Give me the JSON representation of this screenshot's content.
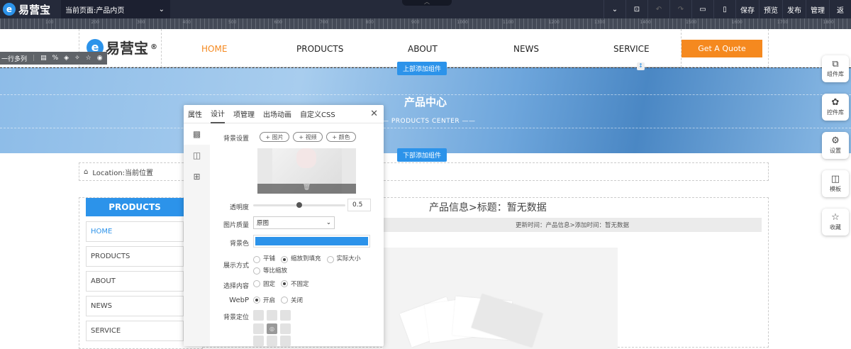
{
  "topbar": {
    "logo_text": "易营宝",
    "page_selector": "当前页面:产品内页",
    "tools": [
      "保存",
      "预览",
      "发布",
      "管理",
      "返"
    ]
  },
  "ruler": {
    "labels": [
      "100",
      "200",
      "300",
      "400",
      "500",
      "600",
      "700",
      "800",
      "900",
      "1000",
      "1100",
      "1200",
      "1300",
      "1400",
      "1500",
      "1600",
      "1700",
      "1800"
    ]
  },
  "header": {
    "logo_text": "易营宝",
    "logo_mark": "®",
    "nav": [
      "HOME",
      "PRODUCTS",
      "ABOUT",
      "NEWS",
      "SERVICE"
    ],
    "quote_button": "Get A Quote"
  },
  "row_toolbar": {
    "label": "一行多列"
  },
  "banner": {
    "add_top": "上部添加组件",
    "title": "产品中心",
    "subtitle": "PRODUCTS CENTER",
    "add_bottom": "下部添加组件"
  },
  "dock": [
    {
      "icon": "copy-icon",
      "label": "组件库"
    },
    {
      "icon": "puzzle-icon",
      "label": "控件库"
    },
    {
      "icon": "gear-icon",
      "label": "设置"
    },
    {
      "icon": "layout-icon",
      "label": "模板"
    },
    {
      "icon": "star-icon",
      "label": "收藏"
    }
  ],
  "breadcrumb": {
    "text": "Location:当前位置"
  },
  "sidebar": {
    "title": "PRODUCTS",
    "items": [
      "HOME",
      "PRODUCTS",
      "ABOUT",
      "NEWS",
      "SERVICE"
    ]
  },
  "product": {
    "title": "产品信息>标题：暂无数据",
    "meta": "更新时间：产品信息>添加时间：暂无数据"
  },
  "panel": {
    "tabs": [
      "属性",
      "设计",
      "项管理",
      "出场动画",
      "自定义CSS"
    ],
    "active_tab": "设计",
    "bg_label": "背景设置",
    "bg_buttons": [
      "+ 图片",
      "+ 视频",
      "+ 颜色"
    ],
    "opacity_label": "透明度",
    "opacity_value": "0.5",
    "opacity": 0.5,
    "quality_label": "图片质量",
    "quality_value": "原图",
    "bgcolor_label": "背景色",
    "bgcolor": "#2c93ea",
    "display_label": "展示方式",
    "display_options": [
      "平铺",
      "缩放到填充",
      "实际大小",
      "等比缩放"
    ],
    "display_selected": "缩放到填充",
    "content_label": "选择内容",
    "content_options": [
      "固定",
      "不固定"
    ],
    "content_selected": "不固定",
    "webp_label": "WebP",
    "webp_options": [
      "开启",
      "关闭"
    ],
    "webp_selected": "开启",
    "position_label": "背景定位"
  },
  "colors": {
    "accent": "#2c93ea",
    "orange": "#f5891f",
    "topbar": "#252a3a"
  }
}
